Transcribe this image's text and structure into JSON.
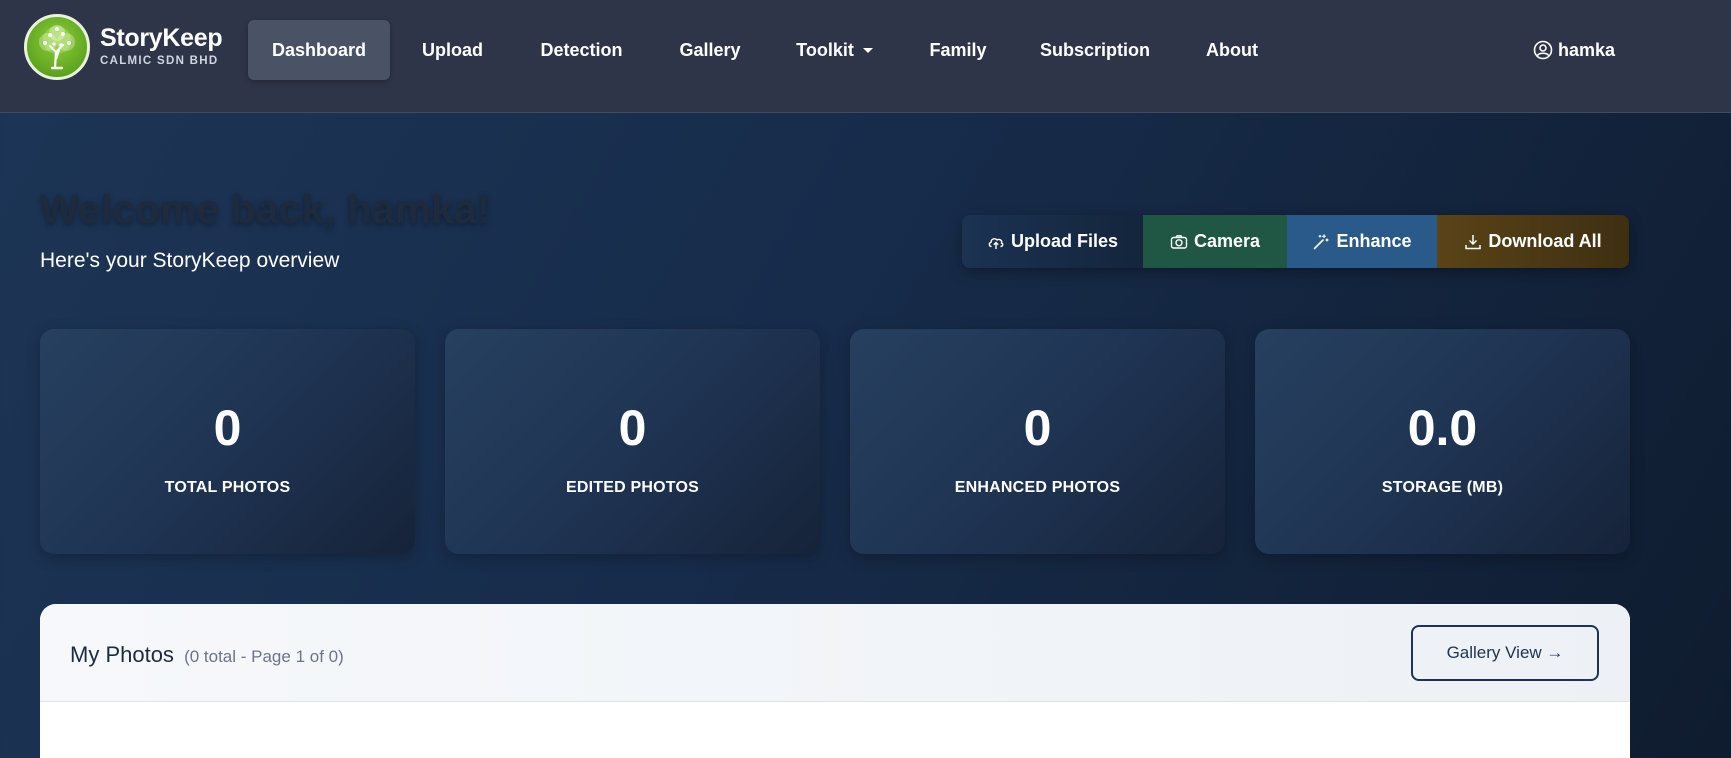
{
  "brand": {
    "name": "StoryKeep",
    "subtitle": "CALMIC SDN BHD"
  },
  "nav": {
    "items": [
      {
        "label": "Dashboard",
        "active": true
      },
      {
        "label": "Upload"
      },
      {
        "label": "Detection"
      },
      {
        "label": "Gallery"
      },
      {
        "label": "Toolkit",
        "dropdown": true
      },
      {
        "label": "Family"
      },
      {
        "label": "Subscription"
      },
      {
        "label": "About"
      }
    ],
    "user": "hamka"
  },
  "welcome": {
    "title": "Welcome back, hamka!",
    "subtitle": "Here's your StoryKeep overview"
  },
  "actions": {
    "upload": "Upload Files",
    "camera": "Camera",
    "enhance": "Enhance",
    "download": "Download All"
  },
  "stats": [
    {
      "value": "0",
      "label": "TOTAL PHOTOS"
    },
    {
      "value": "0",
      "label": "EDITED PHOTOS"
    },
    {
      "value": "0",
      "label": "ENHANCED PHOTOS"
    },
    {
      "value": "0.0",
      "label": "STORAGE (MB)"
    }
  ],
  "photos": {
    "title": "My Photos",
    "meta": "(0 total - Page 1 of 0)",
    "gallery_button": "Gallery View →"
  },
  "colors": {
    "navbar": "#2e3548",
    "camera": "#1f5644",
    "enhance": "#2a5a8a",
    "download": "#5a4316"
  }
}
